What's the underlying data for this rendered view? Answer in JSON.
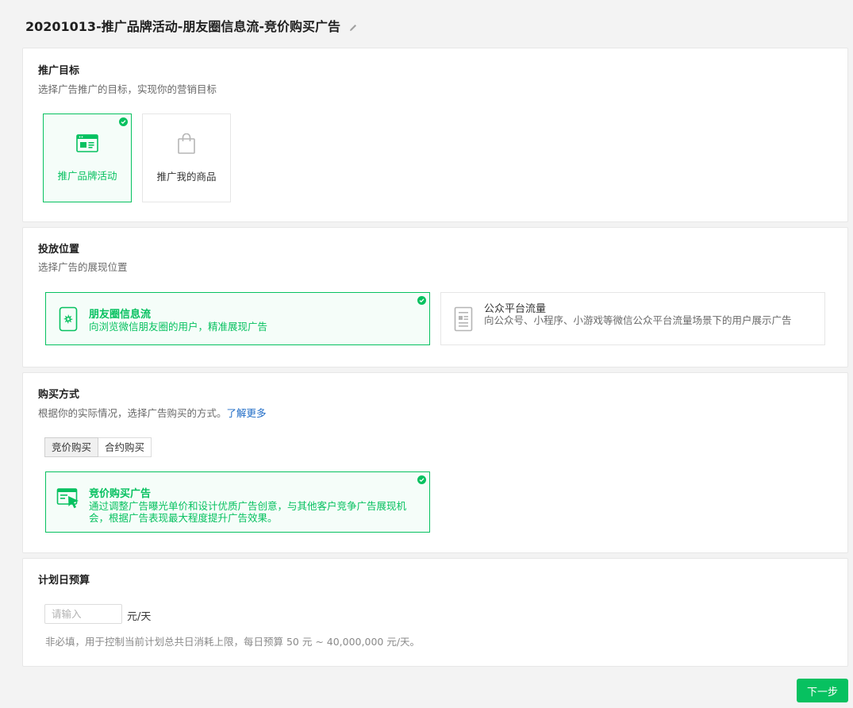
{
  "header": {
    "title": "20201013-推广品牌活动-朋友圈信息流-竞价购买广告",
    "edit_icon": "pencil-icon"
  },
  "goal": {
    "title": "推广目标",
    "desc": "选择广告推广的目标，实现你的营销目标",
    "options": [
      {
        "label": "推广品牌活动",
        "icon": "browser-window-icon",
        "selected": true
      },
      {
        "label": "推广我的商品",
        "icon": "shopping-bag-icon",
        "selected": false
      }
    ]
  },
  "placement": {
    "title": "投放位置",
    "desc": "选择广告的展现位置",
    "options": [
      {
        "title": "朋友圈信息流",
        "desc": "向浏览微信朋友圈的用户，精准展现广告",
        "icon": "moments-icon",
        "selected": true
      },
      {
        "title": "公众平台流量",
        "desc": "向公众号、小程序、小游戏等微信公众平台流量场景下的用户展示广告",
        "icon": "article-page-icon",
        "selected": false
      }
    ]
  },
  "purchase": {
    "title": "购买方式",
    "desc": "根据你的实际情况，选择广告购买的方式。",
    "learn_more": "了解更多",
    "tabs": [
      {
        "label": "竞价购买",
        "active": true
      },
      {
        "label": "合约购买",
        "active": false
      }
    ],
    "option": {
      "title": "竞价购买广告",
      "desc": "通过调整广告曝光单价和设计优质广告创意，与其他客户竞争广告展现机会，根据广告表现最大程度提升广告效果。",
      "icon": "bid-cursor-icon",
      "selected": true
    }
  },
  "budget": {
    "title": "计划日预算",
    "placeholder": "请输入",
    "unit": "元/天",
    "hint": "非必填，用于控制当前计划总共日消耗上限，每日预算 50 元 ~ 40,000,000 元/天。"
  },
  "footer": {
    "next_label": "下一步"
  },
  "colors": {
    "accent": "#07c160",
    "link": "#1e6bc6",
    "background": "#f3f3f3"
  }
}
